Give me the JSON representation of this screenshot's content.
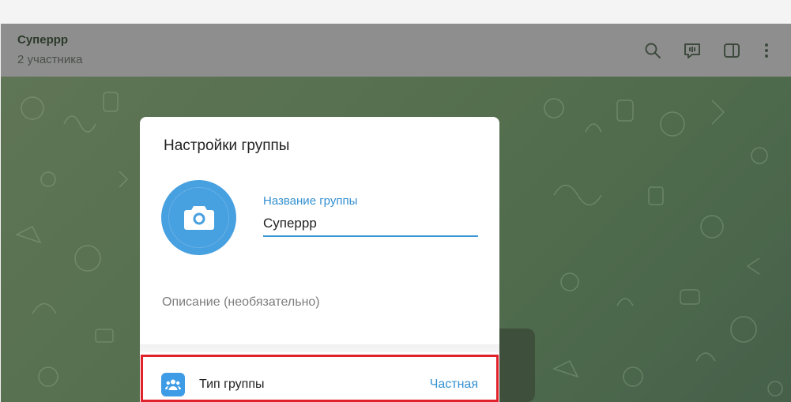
{
  "chat": {
    "title": "Суперрр",
    "subtitle": "2 участника"
  },
  "header_icons": [
    "search-icon",
    "voice-chat-icon",
    "sidebar-toggle-icon",
    "more-vertical-icon"
  ],
  "dialog": {
    "title": "Настройки группы",
    "group_name_label": "Название группы",
    "group_name_value": "Суперрр",
    "description_placeholder": "Описание (необязательно)",
    "group_type_label": "Тип группы",
    "group_type_value": "Частная"
  },
  "colors": {
    "accent": "#3390d0",
    "avatar": "#47a0df",
    "highlight": "#e0222c"
  }
}
